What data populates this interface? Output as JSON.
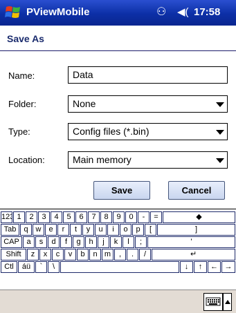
{
  "titlebar": {
    "app_title": "PViewMobile",
    "time": "17:58",
    "conn_glyph": "⚇",
    "vol_glyph": "◀("
  },
  "dialog": {
    "title": "Save As"
  },
  "form": {
    "name_label": "Name:",
    "name_value": "Data",
    "folder_label": "Folder:",
    "folder_value": "None",
    "type_label": "Type:",
    "type_value": "Config files (*.bin)",
    "location_label": "Location:",
    "location_value": "Main memory"
  },
  "buttons": {
    "save": "Save",
    "cancel": "Cancel"
  },
  "keyboard": {
    "rows": [
      [
        "123",
        "1",
        "2",
        "3",
        "4",
        "5",
        "6",
        "7",
        "8",
        "9",
        "0",
        "-",
        "=",
        "◆"
      ],
      [
        "Tab",
        "q",
        "w",
        "e",
        "r",
        "t",
        "y",
        "u",
        "i",
        "o",
        "p",
        "[",
        "]"
      ],
      [
        "CAP",
        "a",
        "s",
        "d",
        "f",
        "g",
        "h",
        "j",
        "k",
        "l",
        ";",
        "'"
      ],
      [
        "Shift",
        "z",
        "x",
        "c",
        "v",
        "b",
        "n",
        "m",
        ",",
        ".",
        "/",
        "↵"
      ],
      [
        "Ctl",
        "áü",
        "`",
        "\\",
        "",
        "↓",
        "↑",
        "←",
        "→"
      ]
    ]
  },
  "icons": {
    "start": "windows-flag-icon",
    "sip": "keyboard-icon"
  }
}
